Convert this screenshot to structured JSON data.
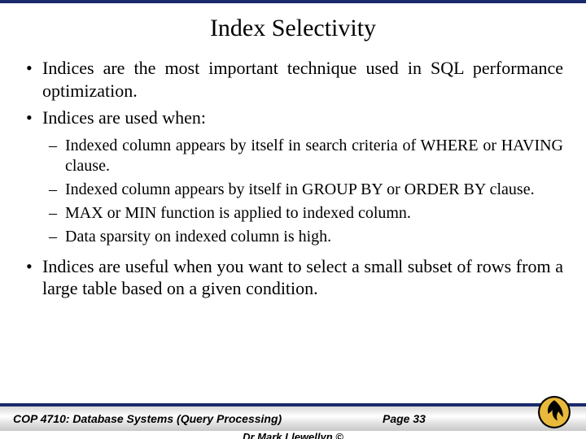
{
  "title": "Index Selectivity",
  "bullets": {
    "b1": "Indices are the most important technique used in SQL performance optimization.",
    "b2": "Indices are used when:",
    "sub1": "Indexed column appears by itself in search criteria of WHERE or HAVING clause.",
    "sub2": "Indexed column appears by itself in GROUP BY or ORDER BY clause.",
    "sub3": "MAX or MIN function is applied to indexed column.",
    "sub4": "Data sparsity on indexed column is high.",
    "b3": "Indices are useful when you want to select a small subset of rows from a large table based on a given condition."
  },
  "footer": {
    "course": "COP 4710: Database Systems (Query Processing)",
    "page": "Page 33",
    "author_partial": "Dr  Mark Llewellyn ©"
  }
}
